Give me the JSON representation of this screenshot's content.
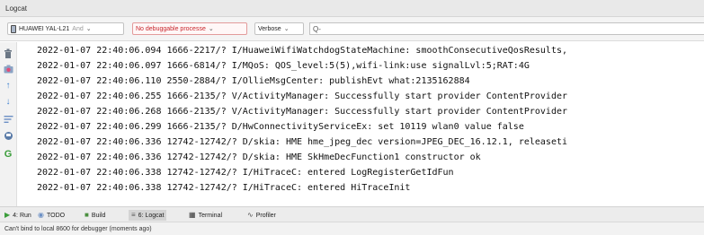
{
  "window": {
    "title": "Logcat"
  },
  "toolbar": {
    "device": {
      "name": "HUAWEI YAL-L21",
      "suffix": "And"
    },
    "process": {
      "value": "No debuggable processe"
    },
    "level": {
      "value": "Verbose"
    },
    "search": {
      "value": "",
      "prefix": "Q-"
    }
  },
  "sidebar": {
    "icons": [
      "trash-icon",
      "camera-icon",
      "arrow-up-icon",
      "arrow-down-icon",
      "soft-wrap-icon",
      "restart-icon",
      "settings-icon"
    ]
  },
  "log": {
    "lines": [
      "2022-01-07 22:40:06.094 1666-2217/? I/HuaweiWifiWatchdogStateMachine: smoothConsecutiveQosResults,",
      "2022-01-07 22:40:06.097 1666-6814/? I/MQoS: QOS_level:5(5),wifi-link:use signalLvl:5;RAT:4G",
      "2022-01-07 22:40:06.110 2550-2884/? I/OllieMsgCenter: publishEvt what:2135162884",
      "2022-01-07 22:40:06.255 1666-2135/? V/ActivityManager: Successfully start provider ContentProvider",
      "2022-01-07 22:40:06.268 1666-2135/? V/ActivityManager: Successfully start provider ContentProvider",
      "2022-01-07 22:40:06.299 1666-2135/? D/HwConnectivityServiceEx: set 10119 wlan0 value false",
      "2022-01-07 22:40:06.336 12742-12742/? D/skia: HME hme_jpeg_dec version=JPEG_DEC_16.12.1, releaseti",
      "2022-01-07 22:40:06.336 12742-12742/? D/skia: HME SkHmeDecFunction1 constructor ok",
      "2022-01-07 22:40:06.338 12742-12742/? I/HiTraceC: entered LogRegisterGetIdFun",
      "2022-01-07 22:40:06.338 12742-12742/? I/HiTraceC: entered HiTraceInit"
    ]
  },
  "toolwindows": [
    {
      "label": "4: Run",
      "icon": "run-icon"
    },
    {
      "label": "TODO",
      "icon": "todo-icon"
    },
    {
      "label": "Build",
      "icon": "build-icon"
    },
    {
      "label": "6: Logcat",
      "icon": "logcat-icon",
      "active": true
    },
    {
      "label": "Terminal",
      "icon": "terminal-icon"
    },
    {
      "label": "Profiler",
      "icon": "profiler-icon"
    }
  ],
  "status": {
    "message": "Can't bind to local 8600 for debugger (moments ago)"
  },
  "colors": {
    "accent": "#3d7fcf",
    "error_text": "#c8262c",
    "run_green": "#3a9d3a"
  }
}
